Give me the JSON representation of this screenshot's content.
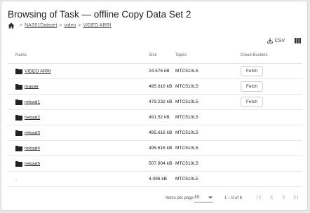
{
  "header": {
    "title": "Browsing of Task — offline Copy Data Set 2"
  },
  "breadcrumb": {
    "items": [
      "NAS01Dataset",
      "video",
      "VIDEO ARRI"
    ]
  },
  "toolbar": {
    "csv_label": "CSV"
  },
  "table": {
    "columns": {
      "name": "Name",
      "size": "Size",
      "tapes": "Tapes",
      "cloud": "Cloud Buckets"
    },
    "rows": [
      {
        "name": "VIDEO ARRI",
        "size": "24.576 kB",
        "tapes": "MTC510L5",
        "action": "Fetch"
      },
      {
        "name": "master",
        "size": "495.616 kB",
        "tapes": "MTC510L5",
        "action": "Fetch"
      },
      {
        "name": "reload1",
        "size": "479.232 kB",
        "tapes": "MTC510L5",
        "action": "Fetch"
      },
      {
        "name": "reload2",
        "size": "491.52 kB",
        "tapes": "MTC510L5",
        "action": ""
      },
      {
        "name": "reload3",
        "size": "495.616 kB",
        "tapes": "MTC510L5",
        "action": ""
      },
      {
        "name": "reload4",
        "size": "495.616 kB",
        "tapes": "MTC510L5",
        "action": ""
      },
      {
        "name": "reload5",
        "size": "507.904 kB",
        "tapes": "MTC510L5",
        "action": ""
      },
      {
        "name": ".",
        "size": "4.096 kB",
        "tapes": "MTC510L5",
        "action": ""
      }
    ]
  },
  "pagination": {
    "items_per_page_label": "Items per page:",
    "items_per_page": "10",
    "range": "1 – 8 of 8"
  },
  "colors": {
    "text": "#212121",
    "muted": "#666666",
    "border": "#e3e3e3",
    "icon": "#222222"
  }
}
